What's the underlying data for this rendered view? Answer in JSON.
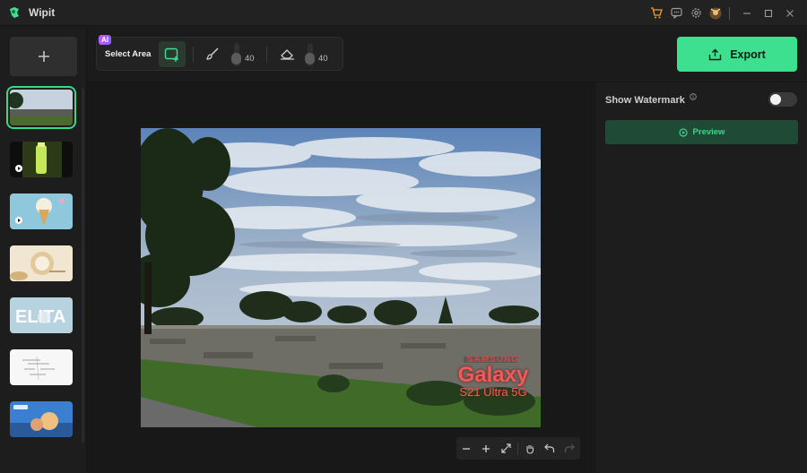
{
  "app": {
    "title": "Wipit",
    "accent": "#39d98a"
  },
  "titlebar": {
    "icons": [
      "cart-icon",
      "feedback-icon",
      "settings-icon",
      "user-avatar-icon"
    ],
    "window_controls": [
      "minimize-icon",
      "maximize-icon",
      "close-icon"
    ]
  },
  "sidebar": {
    "add_label": "+",
    "thumbnails": [
      {
        "name": "landscape-photo",
        "selected": true,
        "type": "image"
      },
      {
        "name": "bottle-video",
        "selected": false,
        "type": "video"
      },
      {
        "name": "icecream-video",
        "selected": false,
        "type": "video"
      },
      {
        "name": "food-banner",
        "selected": false,
        "type": "image"
      },
      {
        "name": "elita-banner",
        "selected": false,
        "type": "image"
      },
      {
        "name": "document-scan",
        "selected": false,
        "type": "image"
      },
      {
        "name": "wipit-promo",
        "selected": false,
        "type": "image"
      }
    ]
  },
  "toolbar": {
    "ai_badge": "AI",
    "select_area_label": "Select Area",
    "brush_size": "40",
    "eraser_size": "40"
  },
  "export": {
    "label": "Export"
  },
  "right_panel": {
    "show_watermark_label": "Show Watermark",
    "show_watermark_on": false,
    "preview_label": "Preview"
  },
  "canvas": {
    "watermark_brand": "SAMSUNG",
    "watermark_main": "Galaxy",
    "watermark_sub": "S21 Ultra 5G"
  },
  "zoom_bar": {
    "buttons": [
      "zoom-out-icon",
      "zoom-in-icon",
      "fit-screen-icon",
      "hand-pan-icon",
      "undo-icon",
      "redo-icon"
    ]
  }
}
